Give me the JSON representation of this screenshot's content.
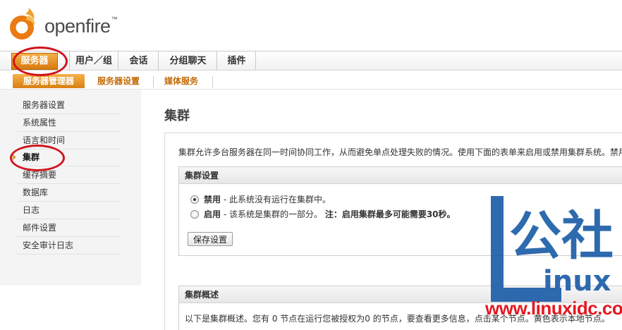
{
  "app": {
    "logo_text": "openfire",
    "logo_tm": "™"
  },
  "main_tabs": [
    {
      "label": "服务器",
      "active": true
    },
    {
      "label": "用户／组",
      "active": false
    },
    {
      "label": "会话",
      "active": false
    },
    {
      "label": "分组聊天",
      "active": false
    },
    {
      "label": "插件",
      "active": false
    }
  ],
  "sub_tabs": [
    {
      "label": "服务器管理器",
      "active": true
    },
    {
      "label": "服务器设置",
      "active": false
    },
    {
      "label": "媒体服务",
      "active": false
    }
  ],
  "sidebar": {
    "items": [
      {
        "label": "服务器设置"
      },
      {
        "label": "系统属性"
      },
      {
        "label": "语言和时间"
      },
      {
        "label": "集群",
        "active": true
      },
      {
        "label": "缓存摘要"
      },
      {
        "label": "数据库"
      },
      {
        "label": "日志"
      },
      {
        "label": "邮件设置"
      },
      {
        "label": "安全审计日志"
      }
    ]
  },
  "page": {
    "title": "集群",
    "intro": "集群允许多台服务器在同一时间协同工作，从而避免单点处理失败的情况。使用下面的表单来启用或禁用集群系统。禁用"
  },
  "cluster_settings": {
    "header": "集群设置",
    "disable_label": "禁用",
    "disable_desc": " - 此系统没有运行在集群中。",
    "enable_label": "启用",
    "enable_desc": " - 该系统是集群的一部分。",
    "note_label": "注：",
    "note_text": "启用集群最多可能需要30秒。",
    "selected": "disable",
    "save_button": "保存设置"
  },
  "cluster_overview": {
    "header": "集群概述",
    "text": "以下是集群概述。您有 0 节点在运行您被授权为0 的节点，要查看更多信息，点击某个节点。黄色表示本地节点。"
  },
  "watermark": {
    "site": "www.linuxidc.com"
  },
  "colors": {
    "accent": "#e0861a",
    "annotation": "#d0141c",
    "watermark_blue": "#1d5ea8"
  },
  "icons": {
    "logo": "openfire-flame-icon",
    "sidebar_marker": "arrow-right-icon"
  }
}
